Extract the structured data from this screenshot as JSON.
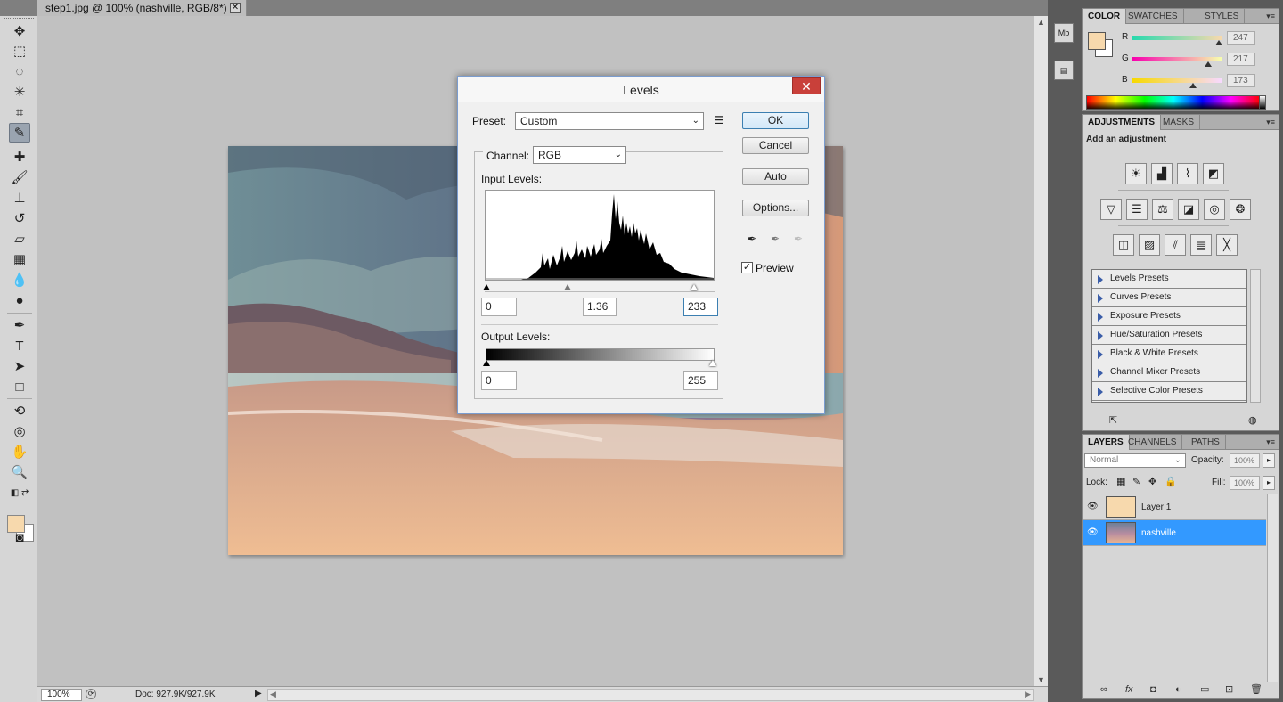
{
  "document": {
    "tab_title": "step1.jpg @ 100% (nashville, RGB/8*) *",
    "close": "✕"
  },
  "statusbar": {
    "zoom": "100%",
    "doc_info": "Doc: 927.9K/927.9K",
    "play": "▶",
    "scroll_left": "◀",
    "scroll_right": "▶"
  },
  "ministrip": {
    "mini1": "Mb",
    "mini2": "▤"
  },
  "color_panel": {
    "tabs": [
      "COLOR",
      "SWATCHES",
      "STYLES"
    ],
    "fg": "#f7d9ad",
    "bg": "#ffffff",
    "sliders": [
      {
        "label": "R",
        "value": "247",
        "fraction": 0.97
      },
      {
        "label": "G",
        "value": "217",
        "fraction": 0.85
      },
      {
        "label": "B",
        "value": "173",
        "fraction": 0.68
      }
    ]
  },
  "adjustments_panel": {
    "tabs": [
      "ADJUSTMENTS",
      "MASKS"
    ],
    "heading": "Add an adjustment",
    "presets": [
      "Levels Presets",
      "Curves Presets",
      "Exposure Presets",
      "Hue/Saturation Presets",
      "Black & White Presets",
      "Channel Mixer Presets",
      "Selective Color Presets"
    ]
  },
  "layers_panel": {
    "tabs": [
      "LAYERS",
      "CHANNELS",
      "PATHS"
    ],
    "blend_mode": "Normal",
    "opacity_label": "Opacity:",
    "opacity": "100%",
    "lock_label": "Lock:",
    "fill_label": "Fill:",
    "fill": "100%",
    "layers": [
      {
        "name": "Layer 1",
        "selected": false
      },
      {
        "name": "nashville",
        "selected": true
      }
    ],
    "footer": [
      "∞",
      "fx",
      "◘",
      "◐",
      "▭",
      "⊡",
      "🗑"
    ]
  },
  "levels_dialog": {
    "title": "Levels",
    "close": "✕",
    "preset_label": "Preset:",
    "preset_value": "Custom",
    "channel_label": "Channel:",
    "channel_value": "RGB",
    "input_levels_label": "Input Levels:",
    "input_black": "0",
    "input_gamma": "1.36",
    "input_white": "233",
    "output_levels_label": "Output Levels:",
    "output_black": "0",
    "output_white": "255",
    "buttons": {
      "ok": "OK",
      "cancel": "Cancel",
      "auto": "Auto",
      "options": "Options..."
    },
    "preview_label": "Preview",
    "preview_checked": true
  }
}
